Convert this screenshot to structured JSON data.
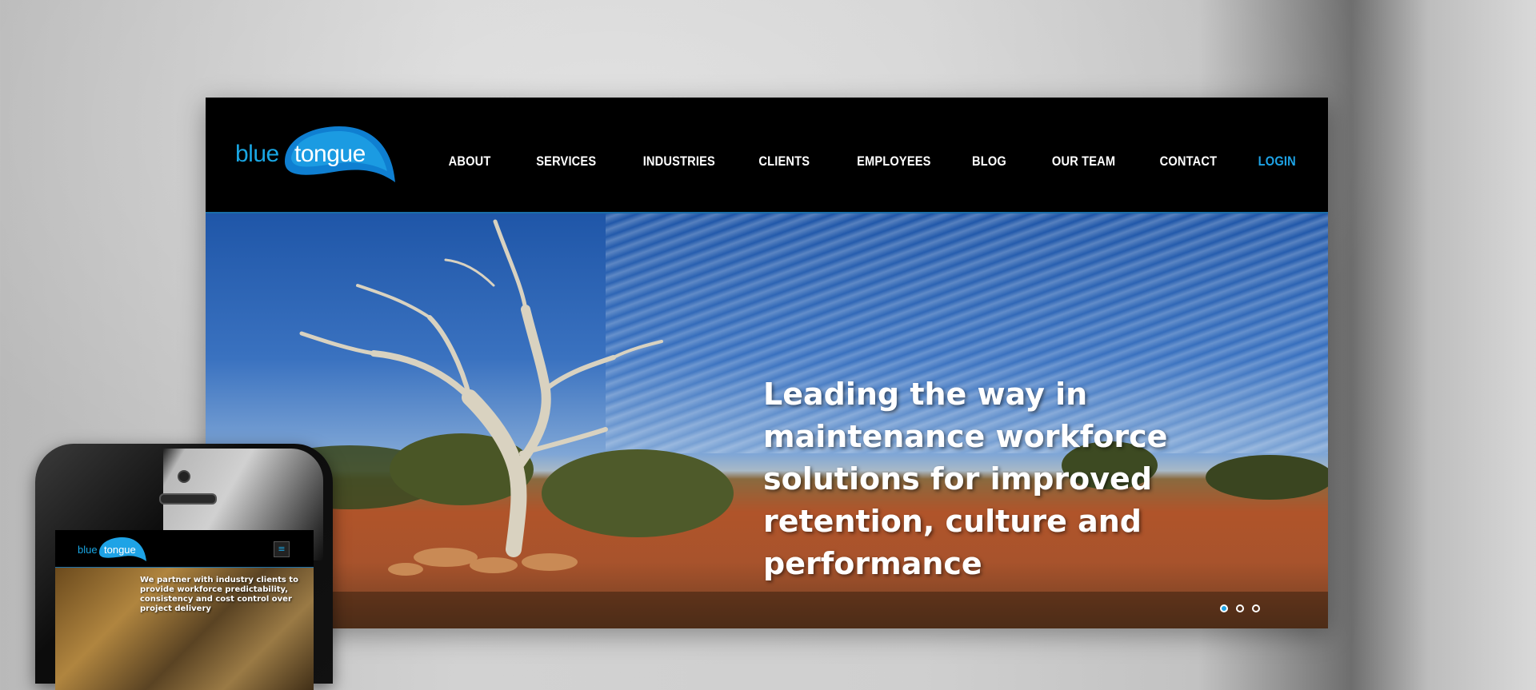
{
  "site": {
    "logo": {
      "word1": "blue",
      "word2": "tongue"
    },
    "nav": [
      {
        "label": "ABOUT"
      },
      {
        "label": "SERVICES"
      },
      {
        "label": "INDUSTRIES"
      },
      {
        "label": "CLIENTS"
      },
      {
        "label": "EMPLOYEES"
      },
      {
        "label": "BLOG"
      },
      {
        "label": "OUR TEAM"
      },
      {
        "label": "CONTACT"
      },
      {
        "label": "LOGIN",
        "active": true
      }
    ],
    "hero": {
      "headline": "Leading the way in maintenance workforce solutions for improved retention, culture and performance",
      "slides": 3,
      "active_slide": 1
    }
  },
  "phone": {
    "logo": {
      "word1": "blue",
      "word2": "tongue"
    },
    "menu_icon": "hamburger-icon",
    "text": "We partner with industry clients to provide workforce predictability, consistency and cost control over project delivery"
  },
  "colors": {
    "accent": "#1ea3e6",
    "header_bg": "#000000"
  }
}
